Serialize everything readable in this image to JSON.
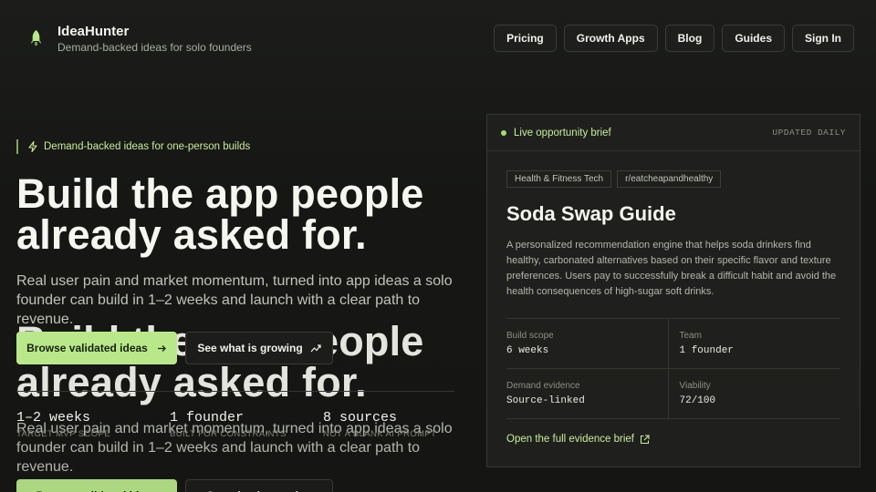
{
  "brand": {
    "name": "IdeaHunter",
    "tagline": "Demand-backed ideas for solo founders",
    "logo_icon": "rocket-icon"
  },
  "nav": {
    "items": [
      "Pricing",
      "Growth Apps",
      "Blog",
      "Guides",
      "Sign In"
    ]
  },
  "hero": {
    "eyebrow": "Demand-backed ideas for one-person builds",
    "eyebrow_icon": "bolt-icon",
    "title": "Build the app people already asked for.",
    "subtitle": "Real user pain and market momentum, turned into app ideas a solo founder can build in 1–2 weeks and launch with a clear path to revenue.",
    "cta_primary": "Browse validated ideas",
    "cta_secondary": "See what is growing",
    "stats": [
      {
        "value": "1–2 weeks",
        "label": "Target MVP scope"
      },
      {
        "value": "1 founder",
        "label": "Built for constraints"
      },
      {
        "value": "8 sources",
        "label": "Not a blank AI prompt"
      }
    ]
  },
  "card": {
    "live_label": "Live opportunity brief",
    "updated": "UPDATED DAILY",
    "tags": [
      "Health & Fitness Tech",
      "r/eatcheapandhealthy"
    ],
    "title": "Soda Swap Guide",
    "description": "A personalized recommendation engine that helps soda drinkers find healthy, carbonated alternatives based on their specific flavor and texture preferences. Users pay to successfully break a difficult habit and avoid the health consequences of high-sugar soft drinks.",
    "metrics": [
      {
        "label": "Build scope",
        "value": "6 weeks"
      },
      {
        "label": "Team",
        "value": "1 founder"
      },
      {
        "label": "Demand evidence",
        "value": "Source-linked"
      },
      {
        "label": "Viability",
        "value": "72/100"
      }
    ],
    "link": "Open the full evidence brief"
  },
  "colors": {
    "accent": "#b9e88a",
    "accent_text": "#c8ec9a",
    "background": "#161715",
    "card": "#1f201d"
  }
}
